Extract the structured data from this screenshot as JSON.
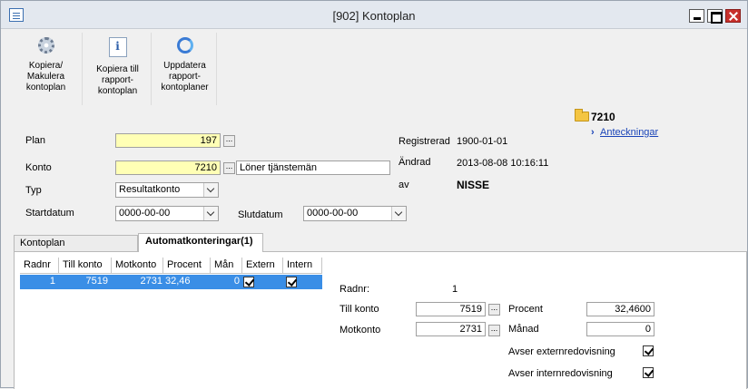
{
  "window": {
    "title": "[902]  Kontoplan"
  },
  "toolbar": {
    "buttons": [
      {
        "label": "Kopiera/\nMakulera\nkontoplan",
        "icon": "gear-copy-icon"
      },
      {
        "label": "Kopiera till\nrapport-\nkontoplan",
        "icon": "info-document-icon"
      },
      {
        "label": "Uppdatera\nrapport-\nkontoplaner",
        "icon": "refresh-icon"
      }
    ]
  },
  "form": {
    "plan_label": "Plan",
    "plan_value": "197",
    "konto_label": "Konto",
    "konto_value": "7210",
    "konto_name": "Löner tjänstemän",
    "typ_label": "Typ",
    "typ_value": "Resultatkonto",
    "startdatum_label": "Startdatum",
    "startdatum_value": "0000-00-00",
    "slutdatum_label": "Slutdatum",
    "slutdatum_value": "0000-00-00",
    "dots": "..."
  },
  "info": {
    "registrerad_label": "Registrerad",
    "registrerad_value": "1900-01-01",
    "andrad_label": "Ändrad",
    "andrad_value": "2013-08-08 10:16:11",
    "av_label": "av",
    "av_value": "NISSE",
    "account_code": "7210",
    "notes_link": "Anteckningar",
    "chevron": "›"
  },
  "tabs": [
    {
      "label": "Kontoplan",
      "active": false
    },
    {
      "label": "Automatkonteringar(1)",
      "active": true
    }
  ],
  "grid": {
    "columns": [
      "Radnr",
      "Till konto",
      "Motkonto",
      "Procent",
      "Mån",
      "Extern",
      "Intern"
    ],
    "rows": [
      {
        "radnr": "1",
        "till_konto": "7519",
        "motkonto": "2731",
        "procent": "32,46",
        "man": "0",
        "extern": true,
        "intern": true
      }
    ]
  },
  "detail": {
    "radnr_label": "Radnr:",
    "radnr_value": "1",
    "till_konto_label": "Till konto",
    "till_konto_value": "7519",
    "motkonto_label": "Motkonto",
    "motkonto_value": "2731",
    "procent_label": "Procent",
    "procent_value": "32,4600",
    "manad_label": "Månad",
    "manad_value": "0",
    "extern_label": "Avser externredovisning",
    "extern_checked": true,
    "intern_label": "Avser internredovisning",
    "intern_checked": true
  }
}
